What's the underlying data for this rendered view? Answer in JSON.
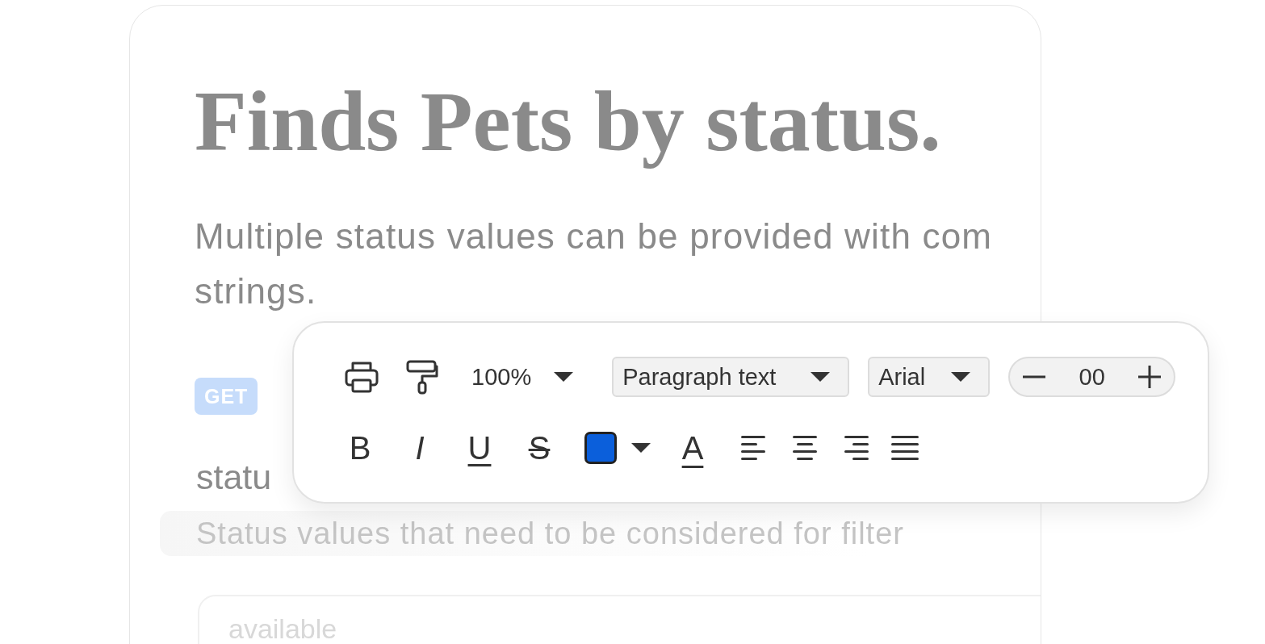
{
  "card": {
    "title": "Finds Pets by status.",
    "description_lines": [
      "Multiple status values can be provided with com",
      "strings."
    ],
    "method_badge": "GET",
    "parameter": {
      "name": "statu",
      "description": "Status values that need to be considered for filter",
      "placeholder": "available"
    }
  },
  "toolbar": {
    "zoom": "100%",
    "paragraph_style": "Paragraph text",
    "font": "Arial",
    "font_size": "00",
    "color_swatch": {
      "color": "#0b5fdb"
    },
    "text_color_label": "A",
    "format_buttons": [
      {
        "kind": "bold",
        "label": "B"
      },
      {
        "kind": "italic",
        "label": "I"
      },
      {
        "kind": "underline",
        "label": "U"
      },
      {
        "kind": "strikethrough",
        "label": "S"
      }
    ],
    "align_buttons": [
      {
        "kind": "left"
      },
      {
        "kind": "center"
      },
      {
        "kind": "right"
      },
      {
        "kind": "justify"
      }
    ]
  }
}
